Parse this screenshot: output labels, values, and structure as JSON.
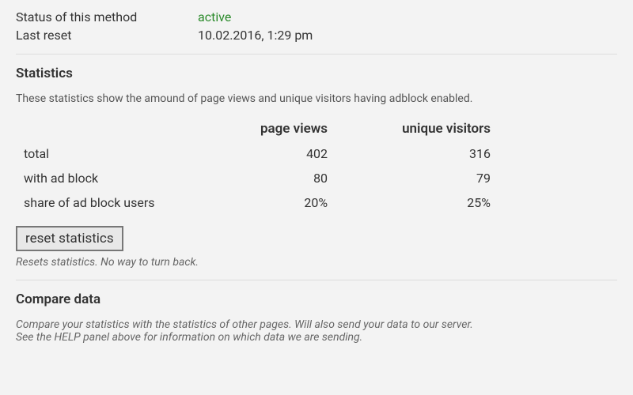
{
  "info": {
    "status_label": "Status of this method",
    "status_value": "active",
    "lastreset_label": "Last reset",
    "lastreset_value": "10.02.2016, 1:29 pm"
  },
  "stats": {
    "heading": "Statistics",
    "desc": "These statistics show the amound of page views and unique visitors having adblock enabled.",
    "col_blank": "",
    "col_pv": "page views",
    "col_uv": "unique visitors",
    "rows": {
      "total": {
        "label": "total",
        "pv": "402",
        "uv": "316"
      },
      "withab": {
        "label": "with ad block",
        "pv": "80",
        "uv": "79"
      },
      "share": {
        "label": "share of ad block users",
        "pv": "20%",
        "uv": "25%"
      }
    },
    "reset_btn": "reset statistics",
    "reset_note": "Resets statistics. No way to turn back."
  },
  "compare": {
    "heading": "Compare data",
    "desc_line1": "Compare your statistics with the statistics of other pages. Will also send your data to our server.",
    "desc_line2": "See the HELP panel above for information on which data we are sending."
  }
}
